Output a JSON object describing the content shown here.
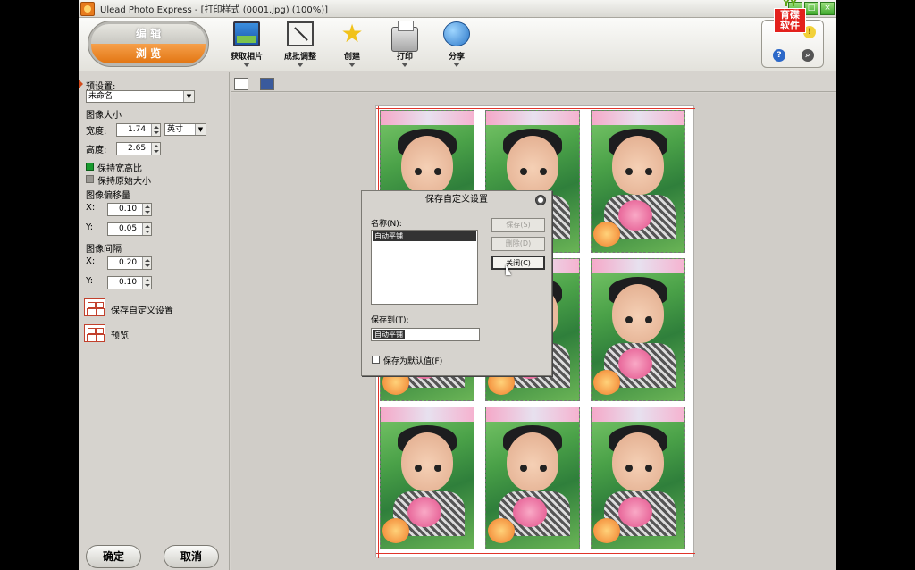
{
  "window": {
    "title": "Ulead Photo Express - [打印样式 (0001.jpg)  (100%)]"
  },
  "brand": {
    "top": "YY",
    "bottom": "育碟软件"
  },
  "mode": {
    "edit": "编 辑",
    "browse": "浏 览"
  },
  "toolbar": {
    "get_photo": "获取相片",
    "batch_adjust": "成批调整",
    "create": "创建",
    "print": "打印",
    "share": "分享"
  },
  "help": {
    "help_icon": "?",
    "search_icon": "🔍",
    "bulb_icon": "💡"
  },
  "left": {
    "preset_label": "预设置:",
    "preset_value": "未命名",
    "image_size": "图像大小",
    "width_label": "宽度:",
    "width_value": "1.74",
    "unit_value": "英寸",
    "height_label": "高度:",
    "height_value": "2.65",
    "keep_ratio": "保持宽高比",
    "keep_ratio_checked": true,
    "keep_original": "保持原始大小",
    "keep_original_checked": false,
    "offset_title": "图像偏移量",
    "x_label": "X:",
    "y_label": "Y:",
    "offset_x": "0.10",
    "offset_y": "0.05",
    "spacing_title": "图像间隔",
    "spacing_x": "0.20",
    "spacing_y": "0.10",
    "save_custom": "保存自定义设置",
    "preview": "预览",
    "ok": "确定",
    "cancel": "取消"
  },
  "dialog": {
    "title": "保存自定义设置",
    "name_label": "名称(N):",
    "list_items": [
      "自动平铺"
    ],
    "save_btn": "保存(S)",
    "delete_btn": "删除(D)",
    "close_btn": "关闭(C)",
    "save_to_label": "保存到(T):",
    "save_to_value": "自动平铺",
    "default_label": "保存为默认值(F)"
  },
  "colors": {
    "accent_orange": "#e27512",
    "selection": "#333333",
    "check_green": "#189a2e"
  }
}
